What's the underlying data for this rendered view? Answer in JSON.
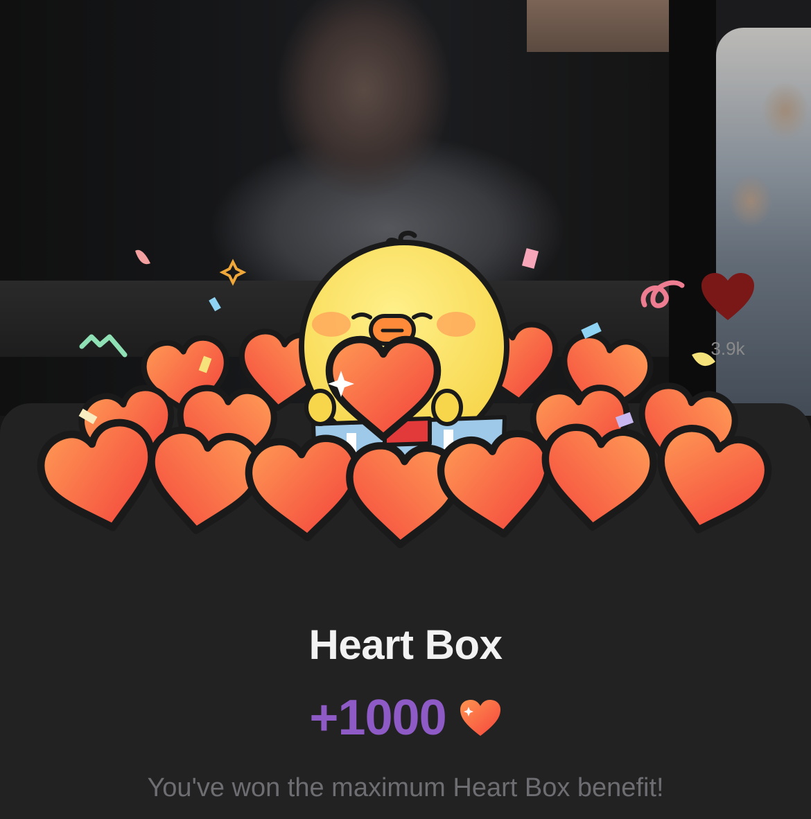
{
  "video_feed": {
    "like_count": "3.9k",
    "like_icon": "heart-icon",
    "colors": {
      "like": "#7a1818"
    }
  },
  "heart_box": {
    "title": "Heart Box",
    "amount": "+1000",
    "amount_icon": "heart-icon",
    "message": "You've won the maximum Heart Box benefit!",
    "illustration": "chick-character-holding-heart-in-pile-of-hearts",
    "colors": {
      "amount": "#8e5bc6",
      "heart_light": "#ff9350",
      "heart_dark": "#f5453c",
      "sheet_background": "#222223"
    }
  }
}
